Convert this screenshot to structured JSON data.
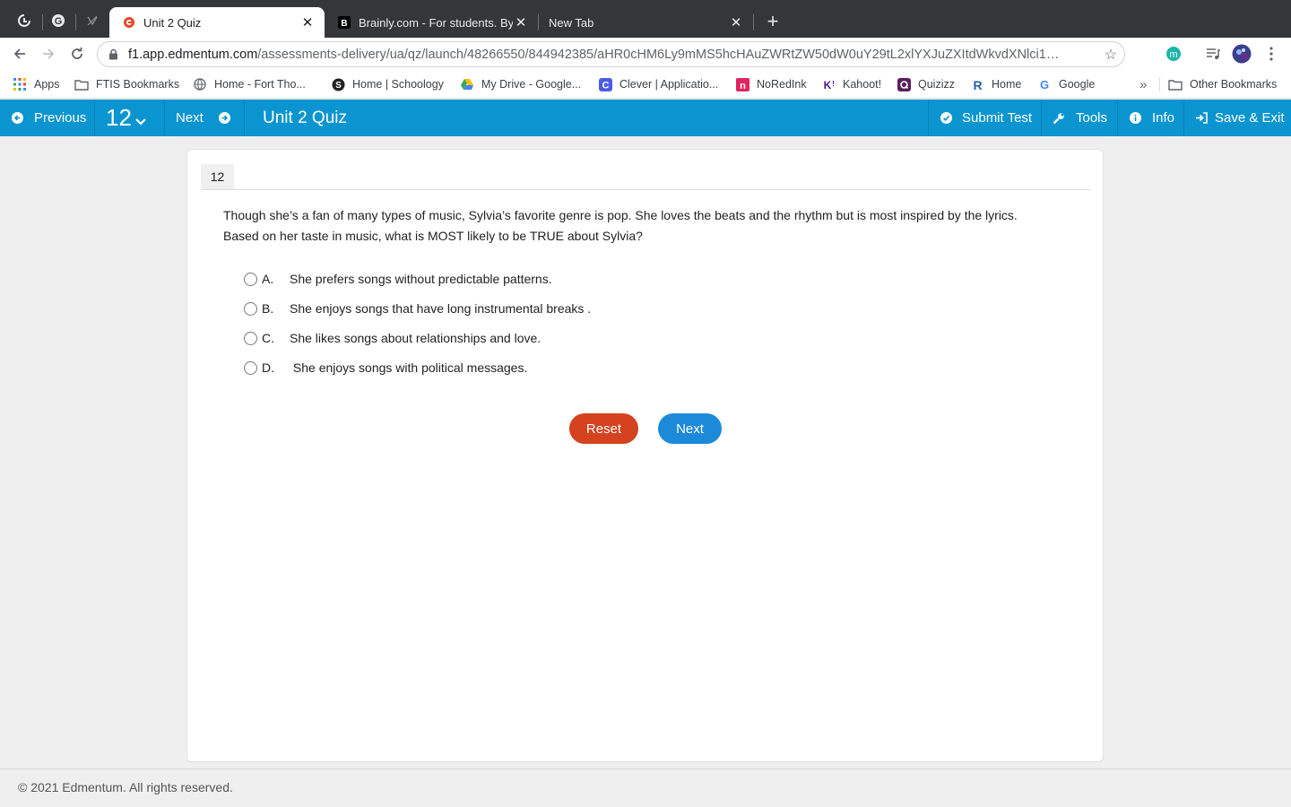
{
  "browser": {
    "tabs": [
      {
        "title": "Unit 2 Quiz",
        "active": true
      },
      {
        "title": "Brainly.com - For students. By",
        "active": false
      },
      {
        "title": "New Tab",
        "active": false
      }
    ],
    "url_host": "f1.app.edmentum.com",
    "url_path": "/assessments-delivery/ua/qz/launch/48266550/844942385/aHR0cHM6Ly9mMS5hcHAuZWRtZW50dW0uY29tL2xlYXJuZXItdWkvdXNlci1…",
    "extension_letter": "m",
    "bookmarks": [
      {
        "label": "Apps",
        "icon": "apps-grid-icon"
      },
      {
        "label": "FTIS Bookmarks",
        "icon": "folder-icon"
      },
      {
        "label": "Home - Fort Tho...",
        "icon": "globe-icon"
      },
      {
        "label": "Home | Schoology",
        "icon": "schoology-icon"
      },
      {
        "label": "My Drive - Google...",
        "icon": "google-drive-icon"
      },
      {
        "label": "Clever | Applicatio...",
        "icon": "clever-icon"
      },
      {
        "label": "NoRedInk",
        "icon": "noredink-icon"
      },
      {
        "label": "Kahoot!",
        "icon": "kahoot-icon"
      },
      {
        "label": "Quizizz",
        "icon": "quizizz-icon"
      },
      {
        "label": "Home",
        "icon": "home-r-icon"
      },
      {
        "label": "Google",
        "icon": "google-icon"
      }
    ],
    "other_bookmarks": "Other Bookmarks",
    "overflow": "»"
  },
  "appbar": {
    "previous": "Previous",
    "question_number": "12",
    "next": "Next",
    "title": "Unit 2 Quiz",
    "submit": "Submit Test",
    "tools": "Tools",
    "info": "Info",
    "save_exit": "Save & Exit",
    "color": "#0b95d0"
  },
  "question": {
    "number": "12",
    "text_line1": "Though she’s a fan of many types of music, Sylvia’s favorite genre is pop. She loves the beats and the rhythm but is most inspired by the lyrics.",
    "text_line2": "Based on her taste in music, what is MOST likely to be TRUE about Sylvia?",
    "options": [
      {
        "letter": "A.",
        "text": "She prefers songs without predictable patterns."
      },
      {
        "letter": "B.",
        "text": "She enjoys songs that have long instrumental breaks ."
      },
      {
        "letter": "C.",
        "text": "She likes songs about relationships and love."
      },
      {
        "letter": "D.",
        "text": " She enjoys songs with political messages."
      }
    ],
    "reset_label": "Reset",
    "next_label": "Next"
  },
  "footer": "© 2021 Edmentum. All rights reserved."
}
